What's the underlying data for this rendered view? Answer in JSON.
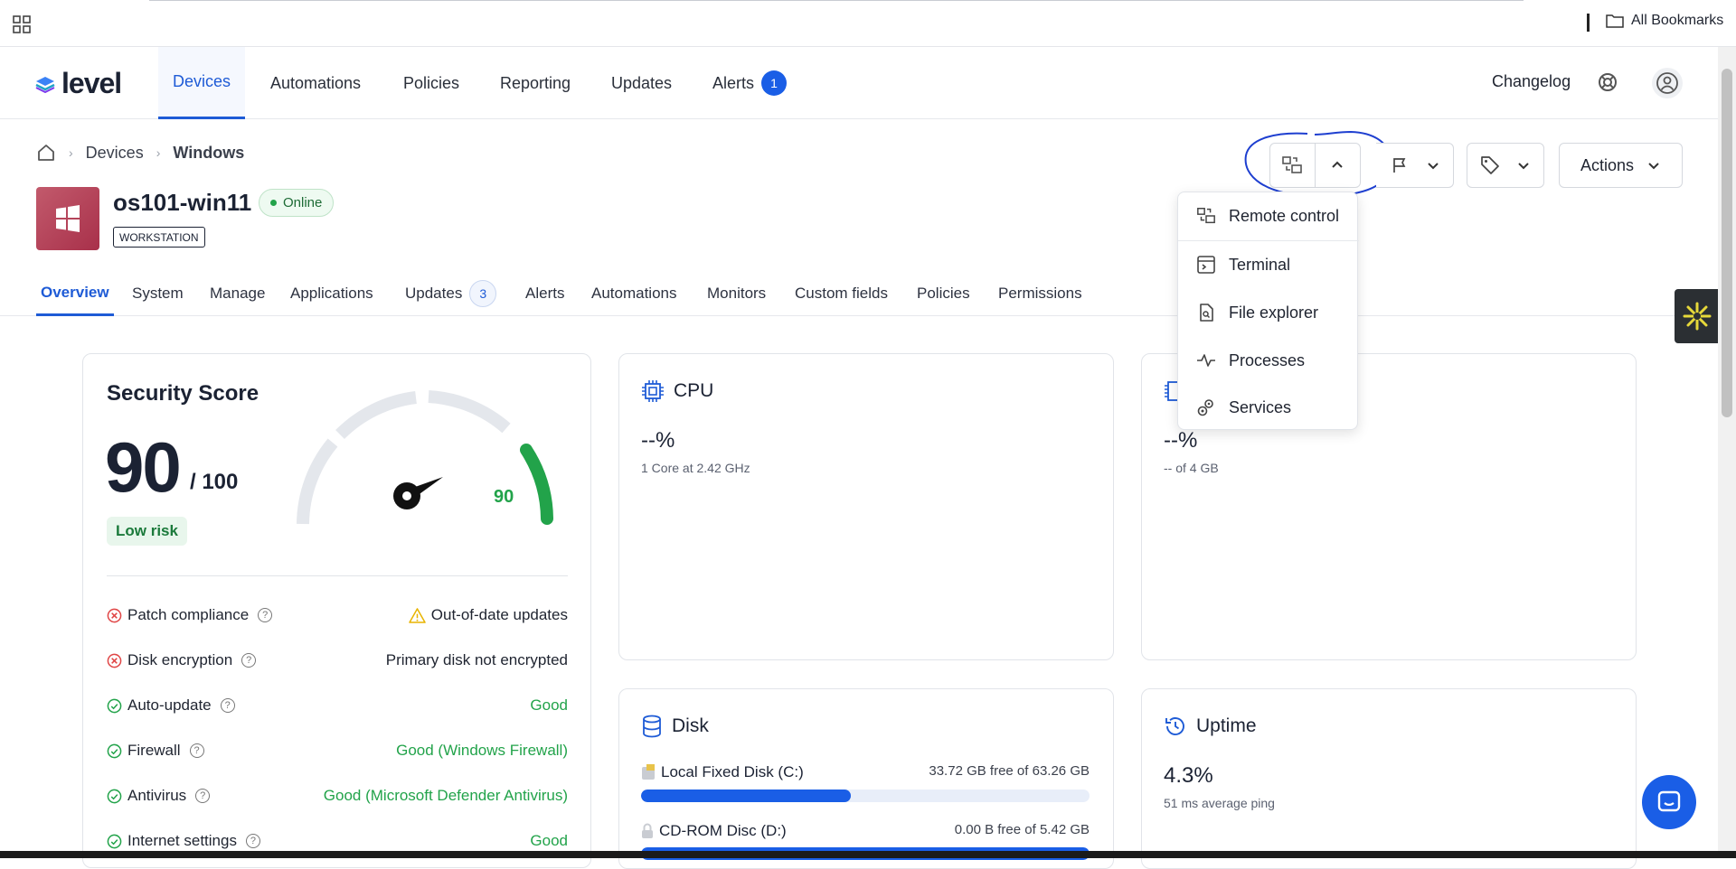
{
  "bookmarks": {
    "all_bookmarks": "All Bookmarks"
  },
  "nav": {
    "logo": "level",
    "items": [
      "Devices",
      "Automations",
      "Policies",
      "Reporting",
      "Updates",
      "Alerts"
    ],
    "alerts_count": "1",
    "changelog": "Changelog"
  },
  "breadcrumb": [
    "Devices",
    "Windows"
  ],
  "device": {
    "name": "os101-win11",
    "status": "Online",
    "type": "WORKSTATION"
  },
  "toolbar": {
    "actions": "Actions"
  },
  "tabs": [
    "Overview",
    "System",
    "Manage",
    "Applications",
    "Updates",
    "Alerts",
    "Automations",
    "Monitors",
    "Custom fields",
    "Policies",
    "Permissions"
  ],
  "updates_count": "3",
  "security": {
    "title": "Security Score",
    "score": "90",
    "out_of": "/ 100",
    "risk": "Low risk",
    "gauge_value": "90",
    "rows": [
      {
        "label": "Patch compliance",
        "value": "Out-of-date updates",
        "status": "warning"
      },
      {
        "label": "Disk encryption",
        "value": "Primary disk not encrypted",
        "status": "bad"
      },
      {
        "label": "Auto-update",
        "value": "Good",
        "status": "good"
      },
      {
        "label": "Firewall",
        "value": "Good (Windows Firewall)",
        "status": "good"
      },
      {
        "label": "Antivirus",
        "value": "Good (Microsoft Defender Antivirus)",
        "status": "good"
      },
      {
        "label": "Internet settings",
        "value": "Good",
        "status": "good"
      }
    ]
  },
  "cpu": {
    "title": "CPU",
    "value": "--%",
    "sub": "1 Core at 2.42 GHz"
  },
  "memory": {
    "value": "--%",
    "sub": "-- of 4 GB"
  },
  "disk": {
    "title": "Disk",
    "items": [
      {
        "name": "Local Fixed Disk (C:)",
        "free": "33.72 GB free of 63.26 GB",
        "used_fraction": 0.467
      },
      {
        "name": "CD-ROM Disc (D:)",
        "free": "0.00 B free of 5.42 GB",
        "used_fraction": 1.0
      }
    ]
  },
  "uptime": {
    "title": "Uptime",
    "value": "4.3%",
    "sub": "51 ms average ping"
  },
  "remote_menu": [
    "Remote control",
    "Terminal",
    "File explorer",
    "Processes",
    "Services"
  ],
  "colors": {
    "accent": "#1a5ee6",
    "good": "#22a34a",
    "bad": "#e04646",
    "warning": "#e8b400"
  }
}
